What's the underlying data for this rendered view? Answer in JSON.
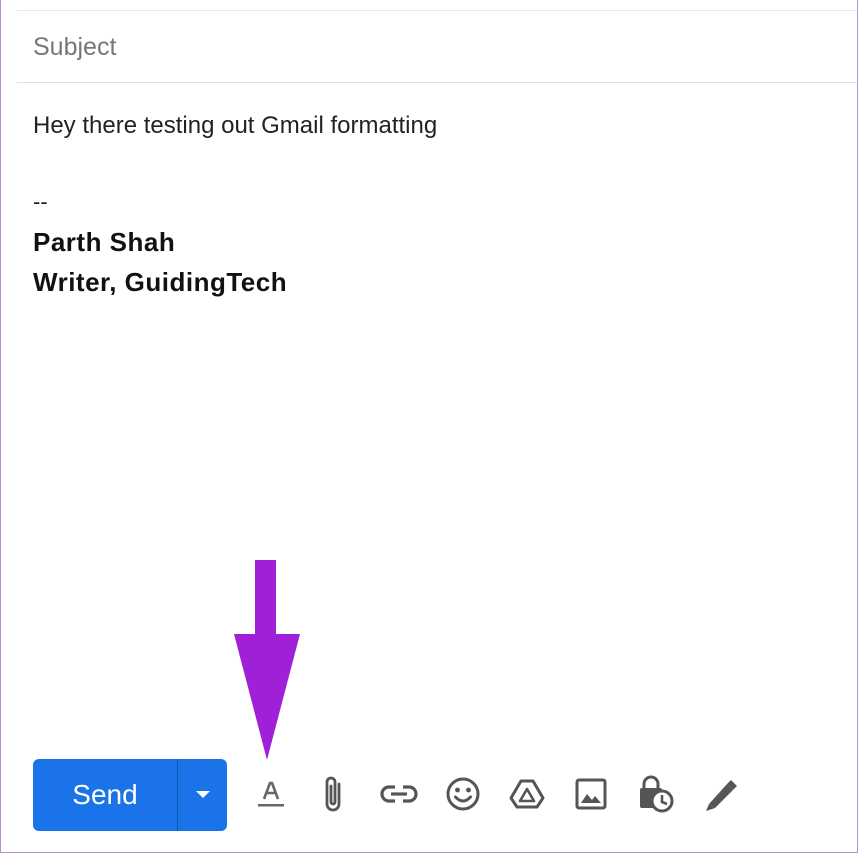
{
  "compose": {
    "subject_placeholder": "Subject",
    "body_text": "Hey there testing out Gmail formatting",
    "signature_separator": "--",
    "signature_name": "Parth Shah",
    "signature_title": "Writer, GuidingTech"
  },
  "toolbar": {
    "send_label": "Send",
    "send_color": "#1a73e8",
    "icons": [
      "formatting-options-icon",
      "attach-file-icon",
      "insert-link-icon",
      "insert-emoji-icon",
      "google-drive-icon",
      "insert-photo-icon",
      "confidential-mode-icon",
      "insert-signature-icon"
    ]
  },
  "annotation": {
    "arrow_color": "#a020d8"
  }
}
